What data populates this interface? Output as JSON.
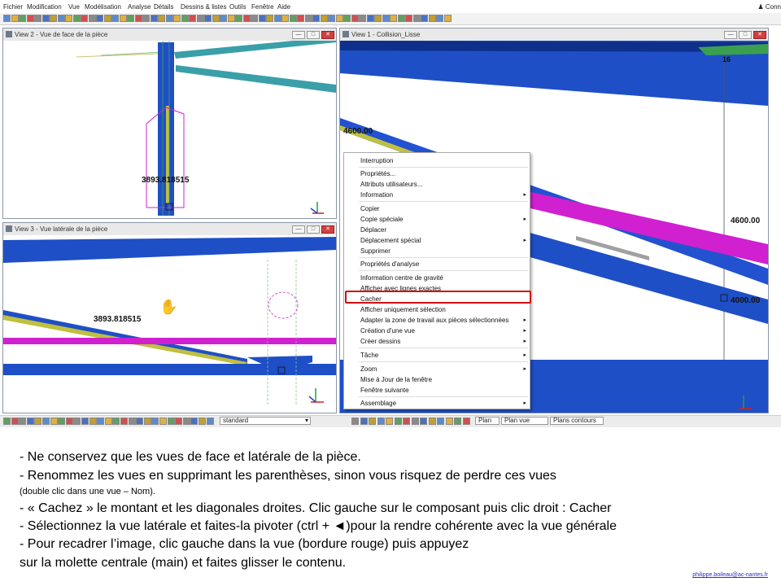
{
  "menubar": {
    "items": [
      "Fichier",
      "Modification",
      "Vue",
      "Modélisation",
      "Analyse",
      "Détails",
      "Dessins & listes",
      "Outils",
      "Fenêtre",
      "Aide"
    ],
    "user_label": "Conn"
  },
  "views": {
    "view2": {
      "title": "View 2 - Vue de face de la pièce",
      "dimension": "3893.818515"
    },
    "view3": {
      "title": "View 3 - Vue latérale de la pièce",
      "dimension": "3893.818515"
    },
    "view1": {
      "title": "View 1 - Collision_Lisse",
      "labels": [
        "4600.00",
        "4600.00",
        "4000.00",
        "16"
      ]
    }
  },
  "window_buttons": {
    "minimize": "—",
    "maximize": "□",
    "close": "✕"
  },
  "context_menu": {
    "items": [
      "Interruption",
      "Propriétés...",
      "Attributs utilisateurs...",
      "Information",
      "Copier",
      "Copie spéciale",
      "Déplacer",
      "Déplacement spécial",
      "Supprimer",
      "Propriétés d'analyse",
      "Information centre de gravité",
      "Afficher avec lignes exactes",
      "Cacher",
      "Afficher uniquement sélection",
      "Adapter la zone de travail aux pièces sélectionnées",
      "Création d'une vue",
      "Créer dessins",
      "Tâche",
      "Zoom",
      "Mise à Jour de la fenêtre",
      "Fenêtre suivante",
      "Assemblage"
    ],
    "highlighted": "Cacher"
  },
  "statusbar": {
    "left_select": "standard",
    "plan": "Plan",
    "plan_view": "Plan vue",
    "plans_contours": "Plans contours"
  },
  "instructions": {
    "line1": "- Ne conservez que les vues de face et latérale de la pièce.",
    "line2": "- Renommez les vues en supprimant les parenthèses, sinon vous risquez de perdre ces vues",
    "line3": "(double clic dans une vue – Nom).",
    "line4": "- « Cachez » le montant et les diagonales droites. Clic gauche sur le composant puis clic droit : Cacher",
    "line5": "- Sélectionnez la vue latérale et faites-la pivoter (ctrl + ◄)pour la rendre cohérente avec la vue générale",
    "line6": "- Pour recadrer l’image, clic gauche dans la vue (bordure rouge) puis appuyez",
    "line7": " sur la molette centrale (main) et faites glisser le contenu."
  },
  "footer_email": "philippe.boileau@ac-nantes.fr",
  "colors": {
    "beam_blue": "#1f4fc6",
    "teal": "#3a9fa8",
    "magenta": "#d020d0",
    "highlight_red": "#d01010"
  }
}
